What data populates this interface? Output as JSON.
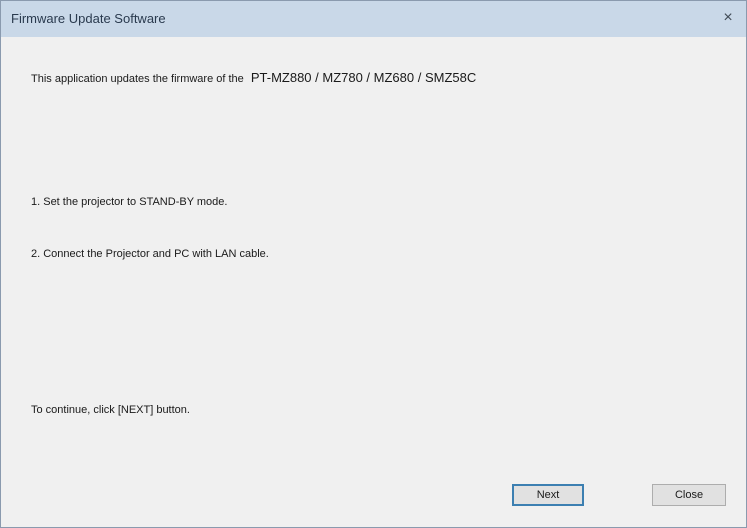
{
  "window": {
    "title": "Firmware Update Software",
    "close_glyph": "×"
  },
  "content": {
    "intro_text": "This application updates the firmware of the",
    "model_name": "PT-MZ880 / MZ780 / MZ680 / SMZ58C",
    "step1": "1. Set the projector to STAND-BY mode.",
    "step2": "2. Connect the Projector and PC with LAN cable.",
    "continue_hint": "To continue, click [NEXT] button."
  },
  "buttons": {
    "next_label": "Next",
    "close_label": "Close"
  },
  "colors": {
    "titlebar": "#c9d8e8",
    "window_bg": "#f0f0f0",
    "default_button_border": "#3c7fb1"
  }
}
